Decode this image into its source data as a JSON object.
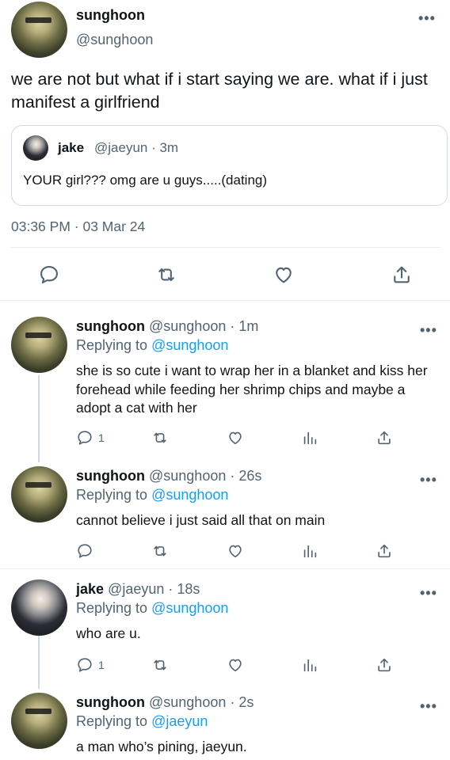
{
  "main_tweet": {
    "name": "sunghoon",
    "handle": "@sunghoon",
    "text": "we are not but what if i start saying we are. what if i just manifest a girlfriend",
    "quoted": {
      "name": "jake",
      "handle_time": "@jaeyun · 3m",
      "text": "YOUR girl??? omg are u guys.....(dating)"
    },
    "timestamp": "03:36 PM · 03 Mar 24",
    "more_label": "•••",
    "actions": [
      "reply-icon",
      "retweet-icon",
      "like-icon",
      "share-icon"
    ]
  },
  "replies": [
    {
      "name": "sunghoon",
      "handle_time": "@sunghoon · 1m",
      "replying_prefix": "Replying to",
      "replying_to": "@sunghoon",
      "text": "she is so cute i want to wrap her in a blanket and kiss her forehead while feeding her shrimp chips and maybe a adopt a cat with her",
      "reply_count": "1",
      "more_label": "•••"
    },
    {
      "name": "sunghoon",
      "handle_time": "@sunghoon · 26s",
      "replying_prefix": "Replying to",
      "replying_to": "@sunghoon",
      "text": "cannot believe i just said all that on main",
      "reply_count": "",
      "more_label": "•••"
    },
    {
      "name": "jake",
      "handle_time": "@jaeyun · 18s",
      "replying_prefix": "Replying to",
      "replying_to": "@sunghoon",
      "text": "who are u.",
      "reply_count": "1",
      "more_label": "•••"
    },
    {
      "name": "sunghoon",
      "handle_time": "@sunghoon · 2s",
      "replying_prefix": "Replying to",
      "replying_to": "@jaeyun",
      "text": "a man who’s pining, jaeyun.",
      "reply_count": "",
      "more_label": "•••"
    }
  ]
}
